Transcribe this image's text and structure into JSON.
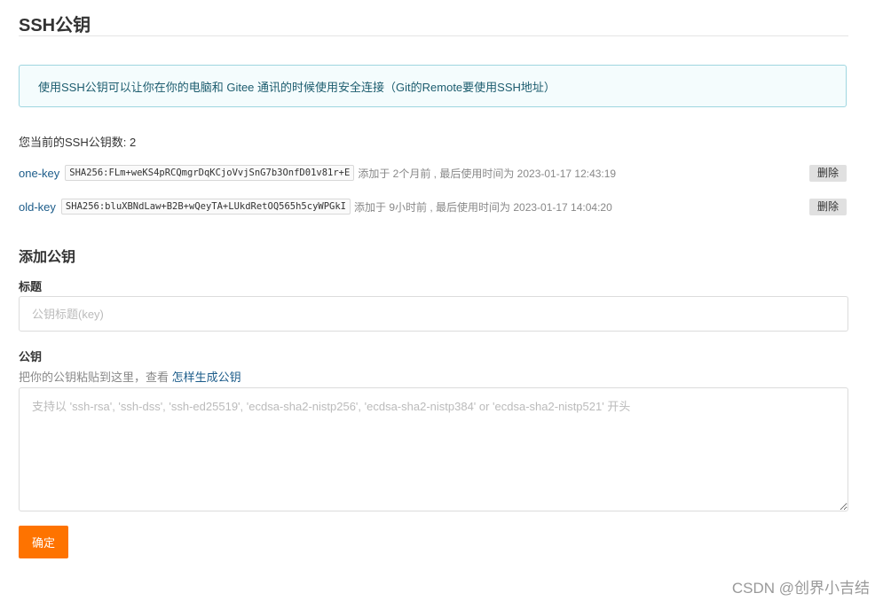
{
  "page": {
    "title": "SSH公钥",
    "info": "使用SSH公钥可以让你在你的电脑和 Gitee 通讯的时候使用安全连接（Git的Remote要使用SSH地址）",
    "key_count_text": "您当前的SSH公钥数: 2"
  },
  "keys": [
    {
      "name": "one-key",
      "fingerprint": "SHA256:FLm+weKS4pRCQmgrDqKCjoVvjSnG7b3OnfD01v81r+E",
      "meta": "添加于 2个月前 , 最后使用时间为 2023-01-17 12:43:19",
      "delete_label": "删除"
    },
    {
      "name": "old-key",
      "fingerprint": "SHA256:bluXBNdLaw+B2B+wQeyTA+LUkdRetOQ565h5cyWPGkI",
      "meta": "添加于 9小时前 , 最后使用时间为 2023-01-17 14:04:20",
      "delete_label": "删除"
    }
  ],
  "add_form": {
    "section_title": "添加公钥",
    "title_label": "标题",
    "title_placeholder": "公钥标题(key)",
    "title_value": "",
    "key_label": "公钥",
    "helper_text": "把你的公钥粘贴到这里，查看 ",
    "helper_link": "怎样生成公钥",
    "key_placeholder": "支持以 'ssh-rsa', 'ssh-dss', 'ssh-ed25519', 'ecdsa-sha2-nistp256', 'ecdsa-sha2-nistp384' or 'ecdsa-sha2-nistp521' 开头",
    "key_value": "",
    "submit_label": "确定"
  },
  "watermark": "CSDN @创界小吉结",
  "colors": {
    "accent_orange": "#fe7300",
    "link_blue": "#1c5c8a",
    "info_border": "#9fd6e0",
    "info_bg": "#f4fcfd"
  }
}
